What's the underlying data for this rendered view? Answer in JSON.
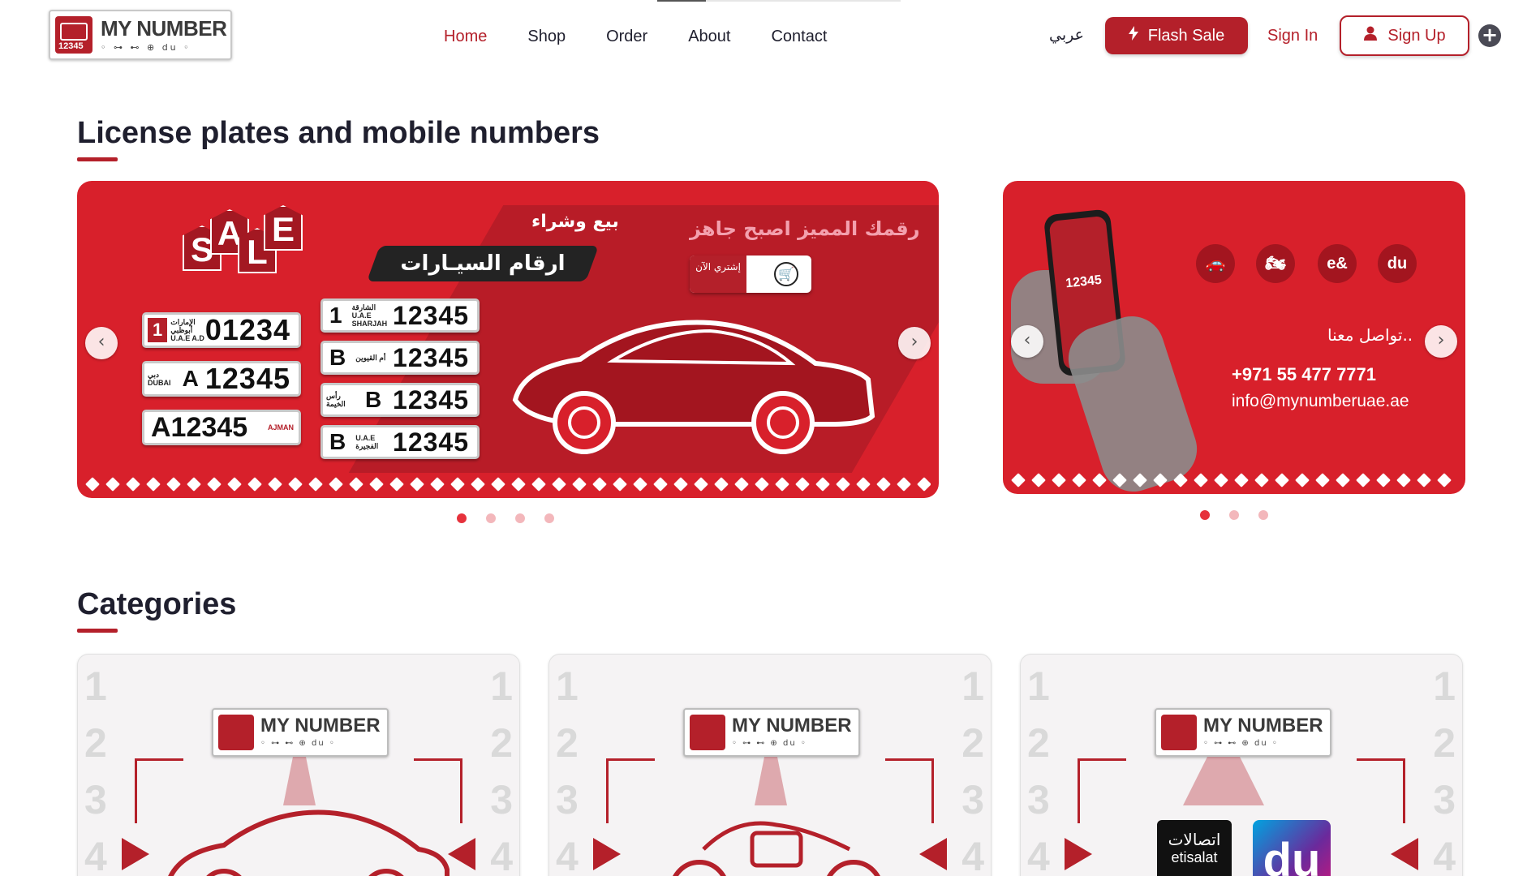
{
  "header": {
    "logo_text": "MY NUMBER",
    "logo_number": "12345",
    "nav": [
      {
        "label": "Home",
        "active": true
      },
      {
        "label": "Shop",
        "active": false
      },
      {
        "label": "Order",
        "active": false
      },
      {
        "label": "About",
        "active": false
      },
      {
        "label": "Contact",
        "active": false
      }
    ],
    "language_toggle": "عربي",
    "flash_sale_label": "Flash Sale",
    "sign_in_label": "Sign In",
    "sign_up_label": "Sign Up",
    "accent_color": "#b4202a"
  },
  "hero": {
    "title": "License plates and mobile numbers",
    "main_banner": {
      "sale_letters": [
        "S",
        "A",
        "L",
        "E"
      ],
      "headline_ar": "رقمك المميز اصبح جاهز",
      "buy_sell_ar": "بيع وشراء",
      "ribbon_ar": "ارقام السيـارات",
      "buy_now_ar": "إشتري الآن",
      "plates_left": [
        {
          "code": "1",
          "emirate": "الإمارات أبوظبي U.A.E A.D",
          "number": "01234"
        },
        {
          "code": "A",
          "emirate": "دبي DUBAI",
          "number": "12345"
        },
        {
          "code": "A12345",
          "emirate": "AJMAN",
          "number": ""
        }
      ],
      "plates_right": [
        {
          "code": "1",
          "emirate": "الشارقة U.A.E SHARJAH",
          "number": "12345"
        },
        {
          "code": "B",
          "emirate": "أم القيوين",
          "number": "12345"
        },
        {
          "code": "B",
          "emirate": "رأس الخيمة",
          "number": "12345"
        },
        {
          "code": "B",
          "emirate": "U.A.E الفجيرة",
          "number": "12345"
        }
      ],
      "slides": 4,
      "active_slide": 0
    },
    "side_banner": {
      "phone_number_label": "12345",
      "contact_label_ar": "تواصل معنا..",
      "phone": "+971 55 477 7771",
      "email": "info@mynumberuae.ae",
      "icons": [
        "car-icon",
        "motorbike-icon",
        "etisalat-icon",
        "du-icon"
      ],
      "slides": 3,
      "active_slide": 0
    }
  },
  "categories": {
    "title": "Categories",
    "cards": [
      {
        "name": "car-plates",
        "illustration": "car"
      },
      {
        "name": "motorbike-plates",
        "illustration": "motorbike"
      },
      {
        "name": "mobile-numbers",
        "illustration": "operators",
        "operator_1_ar": "اتصالات",
        "operator_1_en": "etisalat",
        "operator_2": "du"
      }
    ]
  }
}
